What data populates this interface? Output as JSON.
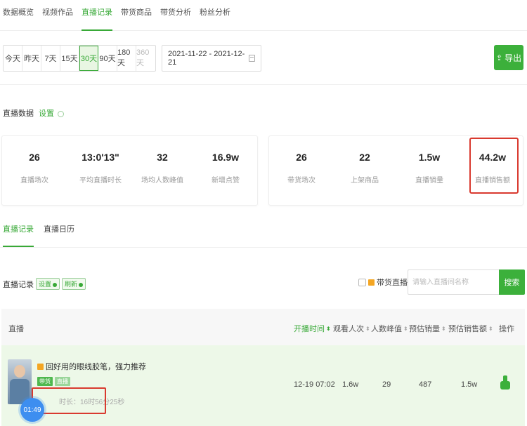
{
  "top_tabs": [
    "数据概览",
    "视频作品",
    "直播记录",
    "带货商品",
    "带货分析",
    "粉丝分析"
  ],
  "range": {
    "options": [
      "今天",
      "昨天",
      "7天",
      "15天",
      "30天",
      "90天",
      "180天",
      "360天"
    ],
    "selected": "30天",
    "date_range": "2021-11-22 - 2021-12-21"
  },
  "export_label": "导出",
  "live_data": {
    "title": "直播数据",
    "setting": "设置",
    "left_stats": [
      {
        "value": "26",
        "label": "直播场次"
      },
      {
        "value": "13:0'13\"",
        "label": "平均直播时长"
      },
      {
        "value": "32",
        "label": "场均人数峰值"
      },
      {
        "value": "16.9w",
        "label": "新增点赞"
      }
    ],
    "right_stats": [
      {
        "value": "26",
        "label": "带货场次"
      },
      {
        "value": "22",
        "label": "上架商品"
      },
      {
        "value": "1.5w",
        "label": "直播销量"
      },
      {
        "value": "44.2w",
        "label": "直播销售额"
      }
    ]
  },
  "sub_tabs": [
    "直播记录",
    "直播日历"
  ],
  "record": {
    "title": "直播记录",
    "setting_pill": "设置",
    "refresh_pill": "刷新",
    "goods_filter": "带货直播",
    "search_placeholder": "请输入直播间名称",
    "search_label": "搜索"
  },
  "table": {
    "headers": {
      "live": "直播",
      "start_time": "开播时间",
      "viewers": "观看人次",
      "peak": "人数峰值",
      "est_sales": "预估销量",
      "est_revenue": "预估销售额",
      "action": "操作"
    },
    "row": {
      "title": "回好用的眼线胶笔，强力推荐",
      "tags": [
        "带货",
        "直播"
      ],
      "duration": "时长：16时56分25秒",
      "start_time": "12-19 07:02",
      "viewers": "1.6w",
      "peak": "29",
      "est_sales": "487",
      "est_revenue": "1.5w"
    }
  },
  "timer": "01:49",
  "colors": {
    "accent": "#38a937",
    "highlight": "#d93a2f",
    "timer": "#3d8ef0"
  }
}
